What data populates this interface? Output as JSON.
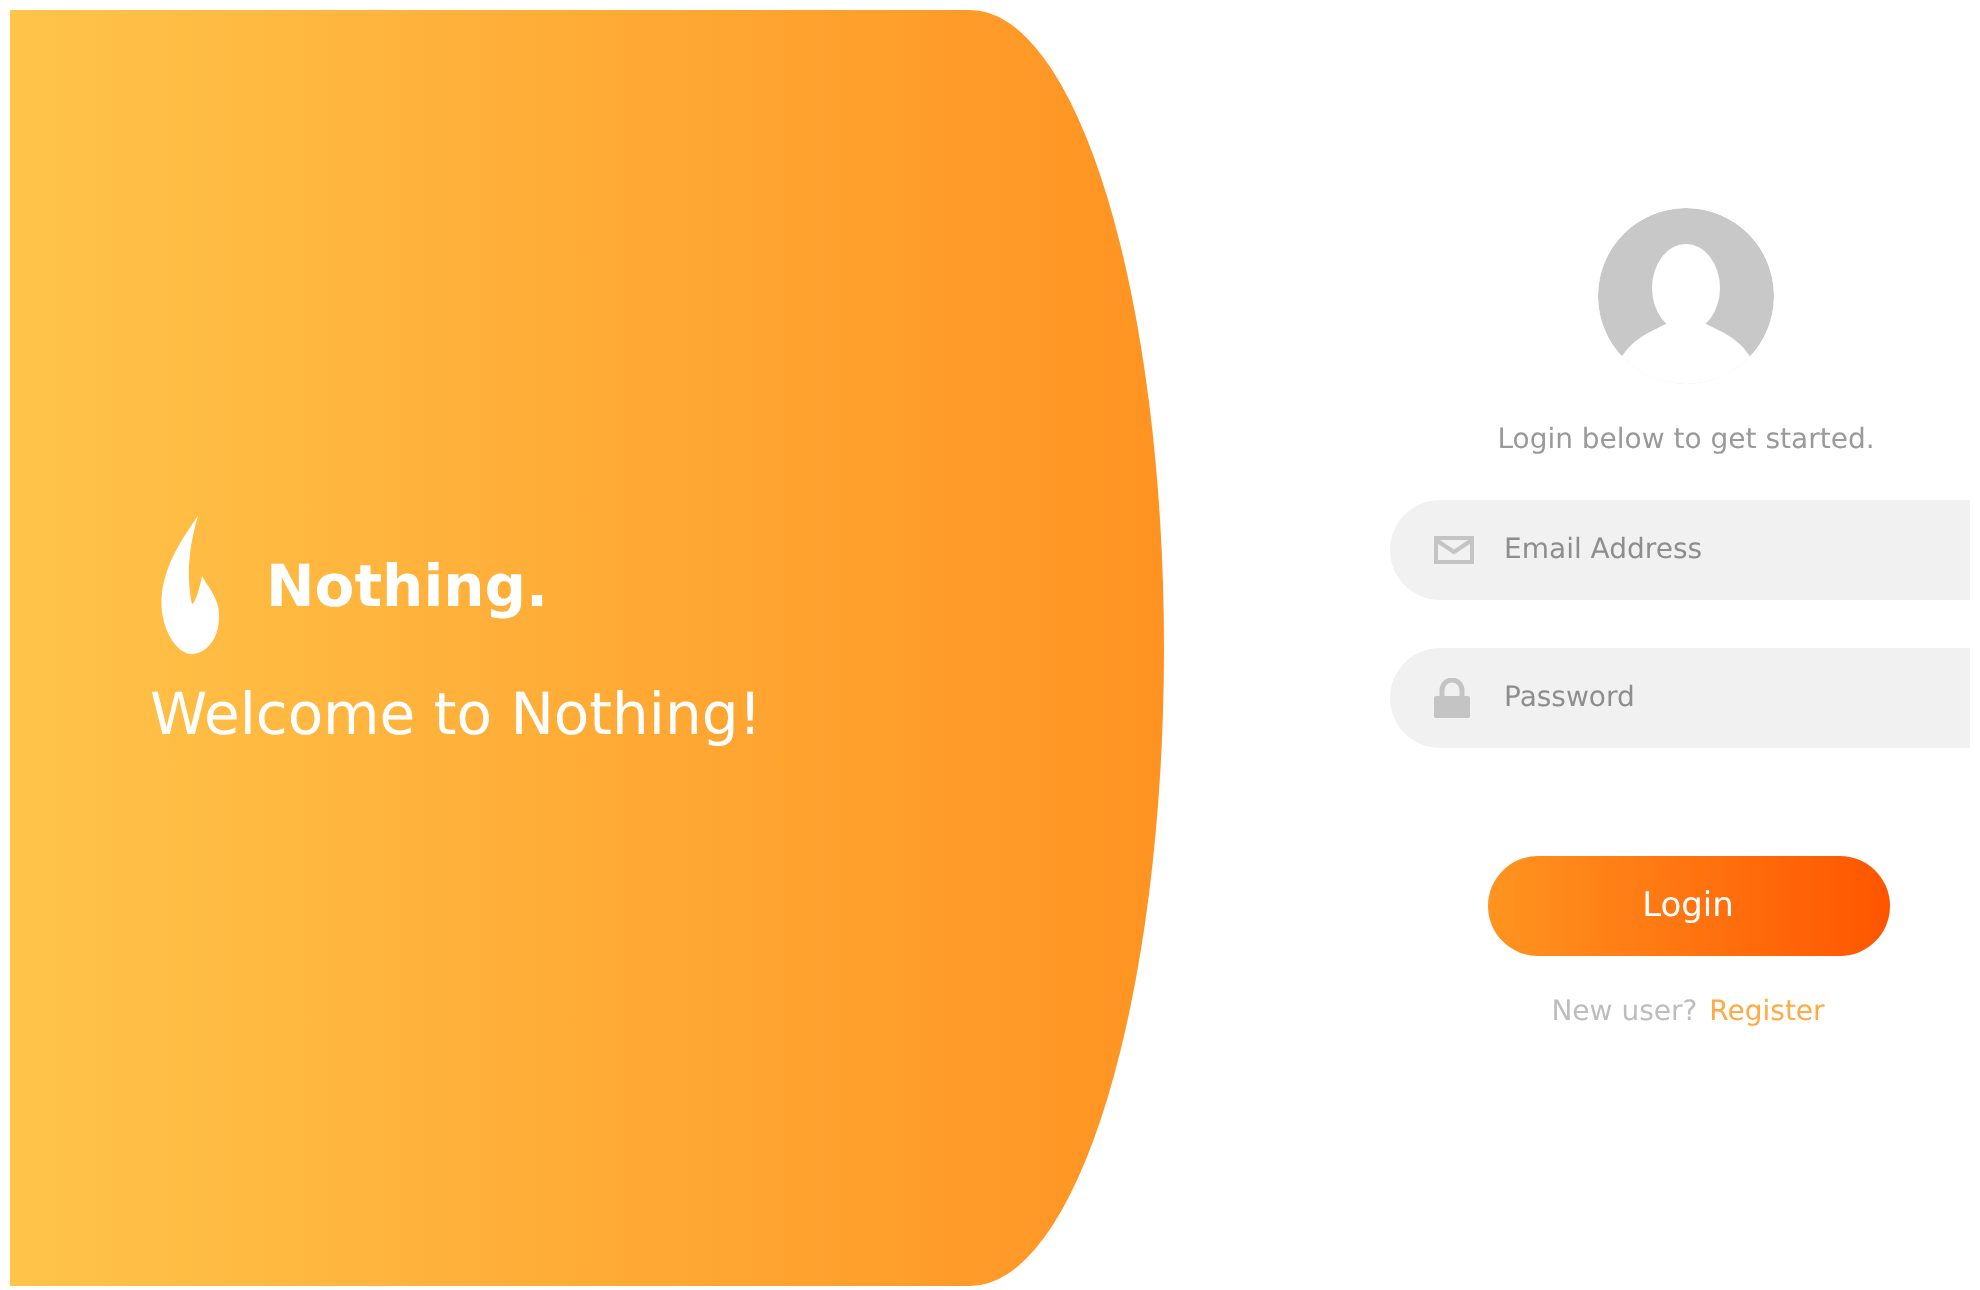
{
  "brand": {
    "name": "Nothing.",
    "welcome": "Welcome to Nothing!"
  },
  "login": {
    "subtitle": "Login below to get started.",
    "fields": [
      {
        "kind": "email",
        "placeholder": "Email Address"
      },
      {
        "kind": "password",
        "placeholder": "Password"
      }
    ],
    "submit": "Login",
    "register_prompt": "New user?",
    "register_link": "Register"
  }
}
